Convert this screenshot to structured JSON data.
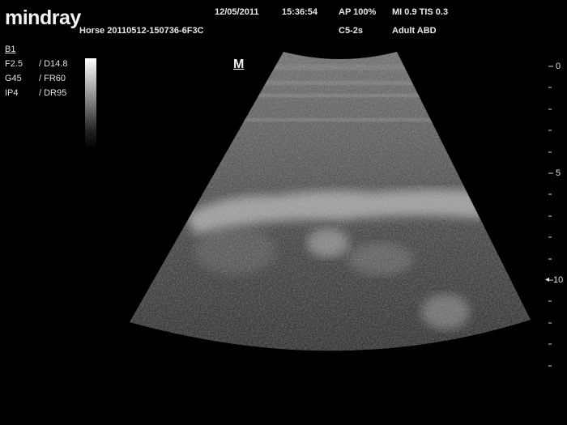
{
  "header": {
    "logo": "mindray",
    "patient_id": "Horse 20110512-150736-6F3C",
    "date": "12/05/2011",
    "time": "15:36:54",
    "acoustic_power": "AP  100%",
    "probe": "C5-2s",
    "index": "MI 0.9  TIS 0.3",
    "preset": "Adult ABD"
  },
  "params": {
    "mode": "B1",
    "freq": "F2.5",
    "depth": "/ D14.8",
    "gain": "G45",
    "frame_rate": "/ FR60",
    "image_proc": "IP4",
    "dyn_range": "/ DR95"
  },
  "orientation_marker": "M",
  "depth_scale": {
    "labels": [
      "0",
      "5",
      "10"
    ],
    "focus_marker": "◂"
  },
  "icons": {
    "grayscale_bar": "grayscale-bar-icon",
    "scan_image": "ultrasound-sector-image"
  }
}
